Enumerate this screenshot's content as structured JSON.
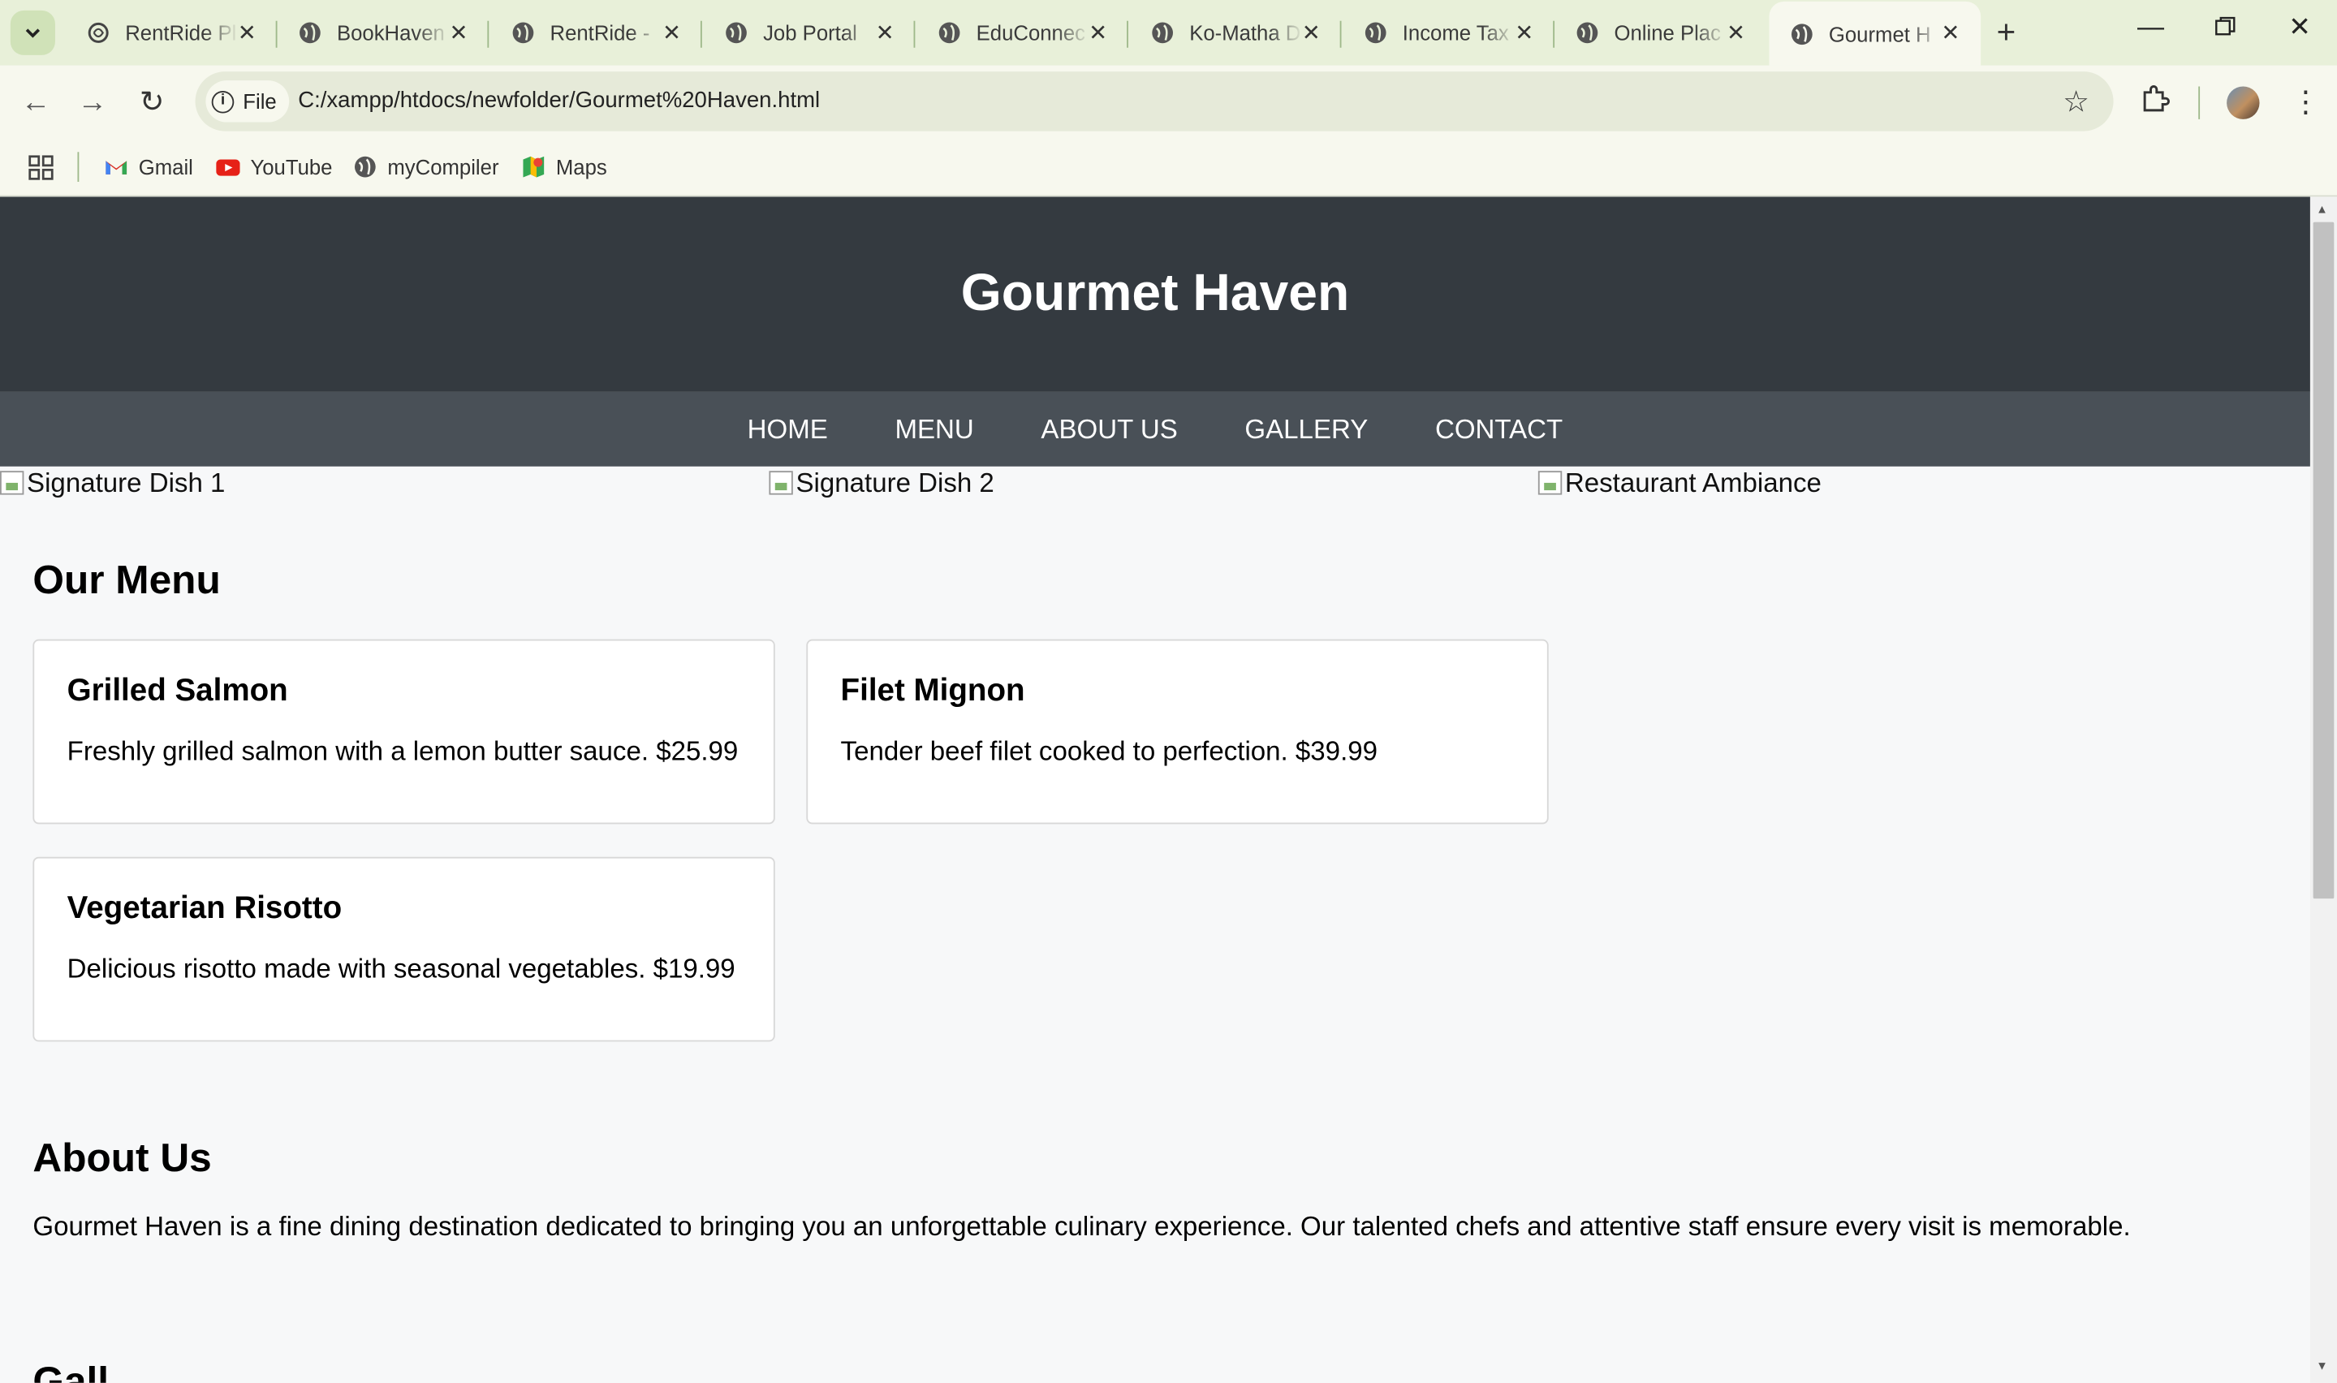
{
  "browser": {
    "tabs": [
      {
        "label": "RentRide Pl",
        "favicon": "ai-icon",
        "active": false
      },
      {
        "label": "BookHaven",
        "favicon": "globe-icon",
        "active": false
      },
      {
        "label": "RentRide -",
        "favicon": "globe-icon",
        "active": false
      },
      {
        "label": "Job Portal",
        "favicon": "globe-icon",
        "active": false
      },
      {
        "label": "EduConnec",
        "favicon": "globe-icon",
        "active": false
      },
      {
        "label": "Ko-Matha D",
        "favicon": "globe-icon",
        "active": false
      },
      {
        "label": "Income Tax",
        "favicon": "globe-icon",
        "active": false
      },
      {
        "label": "Online Plac",
        "favicon": "globe-icon",
        "active": false
      },
      {
        "label": "Gourmet H",
        "favicon": "globe-icon",
        "active": true
      }
    ],
    "site_chip": "File",
    "url": "C:/xampp/htdocs/newfolder/Gourmet%20Haven.html",
    "bookmarks": [
      {
        "label": "Gmail",
        "icon": "gmail-icon"
      },
      {
        "label": "YouTube",
        "icon": "youtube-icon"
      },
      {
        "label": "myCompiler",
        "icon": "globe-icon"
      },
      {
        "label": "Maps",
        "icon": "maps-icon"
      }
    ],
    "colors": {
      "frame": "#e8f0d9",
      "toolbar": "#f7f8ee",
      "omnibox": "#e6ead9"
    }
  },
  "page": {
    "title": "Gourmet Haven",
    "nav": [
      "HOME",
      "MENU",
      "ABOUT US",
      "GALLERY",
      "CONTACT"
    ],
    "hero_images": [
      "Signature Dish 1",
      "Signature Dish 2",
      "Restaurant Ambiance"
    ],
    "menu": {
      "heading": "Our Menu",
      "items": [
        {
          "name": "Grilled Salmon",
          "description": "Freshly grilled salmon with a lemon butter sauce. $25.99"
        },
        {
          "name": "Filet Mignon",
          "description": "Tender beef filet cooked to perfection. $39.99"
        },
        {
          "name": "Vegetarian Risotto",
          "description": "Delicious risotto made with seasonal vegetables. $19.99"
        }
      ]
    },
    "about": {
      "heading": "About Us",
      "text": "Gourmet Haven is a fine dining destination dedicated to bringing you an unforgettable culinary experience. Our talented chefs and attentive staff ensure every visit is memorable."
    },
    "gallery_heading_partial": "Gall",
    "colors": {
      "header": "#343a40",
      "nav": "#495057",
      "background": "#f7f8f9"
    }
  }
}
